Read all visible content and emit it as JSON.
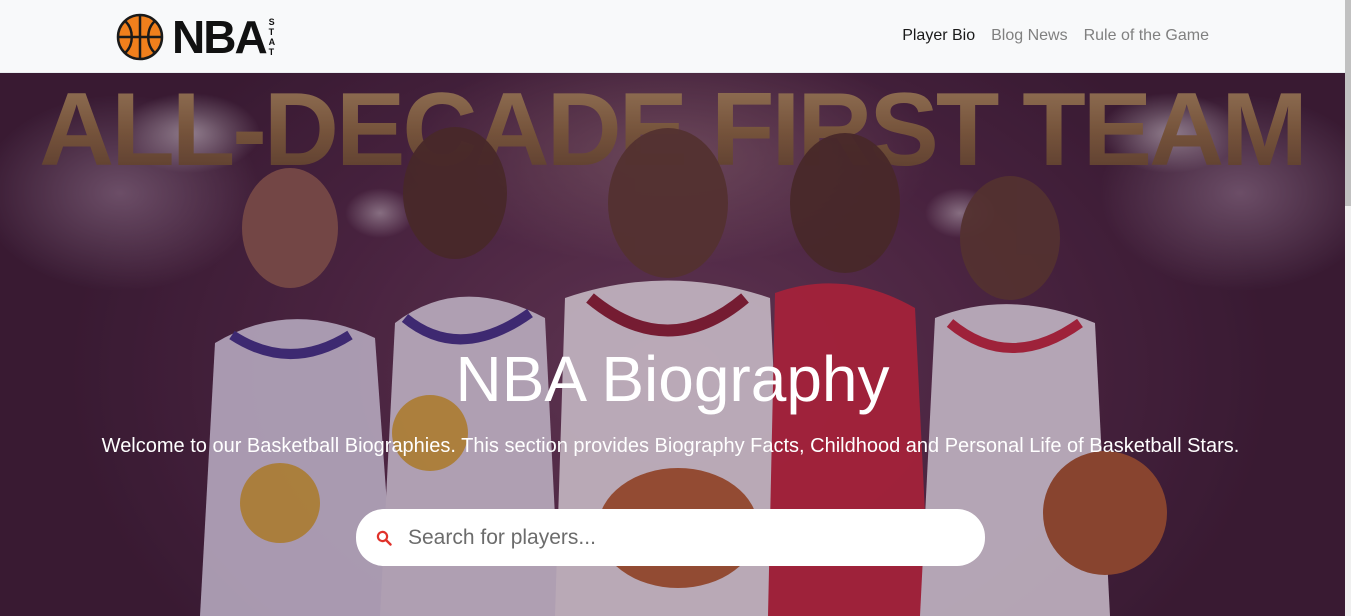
{
  "brand": {
    "name": "NBA",
    "suffix": [
      "S",
      "T",
      "A",
      "T"
    ],
    "icon": "basketball-icon",
    "ball_color": "#f07f1c"
  },
  "nav": {
    "items": [
      {
        "label": "Player Bio",
        "active": true
      },
      {
        "label": "Blog News",
        "active": false
      },
      {
        "label": "Rule of the Game",
        "active": false
      }
    ]
  },
  "hero": {
    "banner_text": "ALL-DECADE FIRST TEAM",
    "title": "NBA Biography",
    "subtitle": "Welcome to our Basketball Biographies. This section provides Biography Facts, Childhood and Personal Life of Basketball Stars.",
    "background_tint": "#4a2540"
  },
  "search": {
    "placeholder": "Search for players...",
    "value": "",
    "icon": "search-icon",
    "icon_color": "#e0322b"
  }
}
